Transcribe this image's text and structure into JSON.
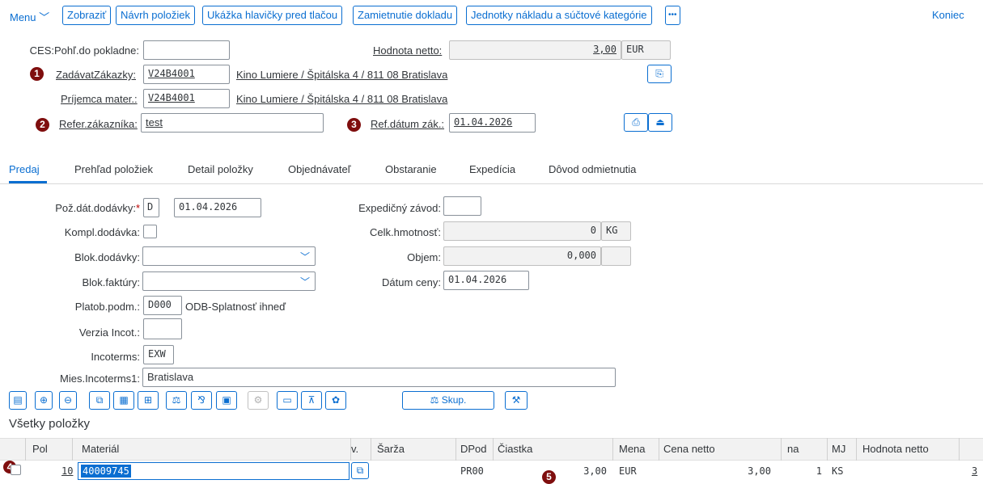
{
  "toolbar": {
    "menu_label": "Menu",
    "buttons": [
      "Zobraziť",
      "Návrh položiek",
      "Ukážka hlavičky pred tlačou",
      "Zamietnutie dokladu",
      "Jednotky nákladu a súčtové kategórie",
      "•••"
    ],
    "exit_label": "Koniec"
  },
  "header": {
    "ces_label": "CES:Pohľ.do pokladne:",
    "ces_value": "",
    "netto_label": "Hodnota netto:",
    "netto_value": "3,00",
    "netto_currency": "EUR",
    "orderer_label": "ZadávatZákazky:",
    "orderer_value": "V24B4001",
    "orderer_desc": "Kino Lumiere / Špitálska 4 / 811 08 Bratislava",
    "recipient_label": "Príjemca mater.:",
    "recipient_value": "V24B4001",
    "recipient_desc": "Kino Lumiere / Špitálska 4 / 811 08 Bratislava",
    "ref_label": "Refer.zákazníka:",
    "ref_value": "test",
    "refdate_label": "Ref.dátum zák.:",
    "refdate_value": "01.04.2026"
  },
  "markers": [
    "1",
    "2",
    "3",
    "4",
    "5"
  ],
  "tabs": [
    "Predaj",
    "Prehľad položiek",
    "Detail položky",
    "Objednávateľ",
    "Obstaranie",
    "Expedícia",
    "Dôvod odmietnutia"
  ],
  "sales": {
    "delivery_date_label": "Pož.dát.dodávky:",
    "delivery_date_type": "D",
    "delivery_date_value": "01.04.2026",
    "complete_label": "Kompl.dodávka:",
    "delivery_block_label": "Blok.dodávky:",
    "billing_block_label": "Blok.faktúry:",
    "payment_label": "Platob.podm.:",
    "payment_value": "D000",
    "payment_desc": "ODB-Splatnosť ihneď",
    "incoversion_label": "Verzia Incot.:",
    "incoterms_label": "Incoterms:",
    "incoterms_value": "EXW",
    "incoplace_label": "Mies.Incoterms1:",
    "incoplace_value": "Bratislava",
    "plant_label": "Expedičný závod:",
    "weight_label": "Celk.hmotnosť:",
    "weight_value": "0",
    "weight_unit": "KG",
    "volume_label": "Objem:",
    "volume_value": "0,000",
    "pricedate_label": "Dátum ceny:",
    "pricedate_value": "01.04.2026"
  },
  "items_toolbar": {
    "group_label": "Skup."
  },
  "items": {
    "title": "Všetky položky",
    "columns": [
      "Pol",
      "Materiál",
      "v.",
      "Šarža",
      "DPod",
      "Čiastka",
      "Mena",
      "Cena netto",
      "na",
      "MJ",
      "Hodnota netto"
    ],
    "rows": [
      {
        "pol": "10",
        "material": "40009745",
        "dpod": "PR00",
        "amount": "3,00",
        "currency": "EUR",
        "price": "3,00",
        "per": "1",
        "unit": "KS",
        "value": "3"
      }
    ]
  },
  "colors": {
    "accent": "#0a6ed1",
    "marker": "#7f0e0e",
    "required": "#bb0000",
    "selection": "#0a6ed1"
  }
}
